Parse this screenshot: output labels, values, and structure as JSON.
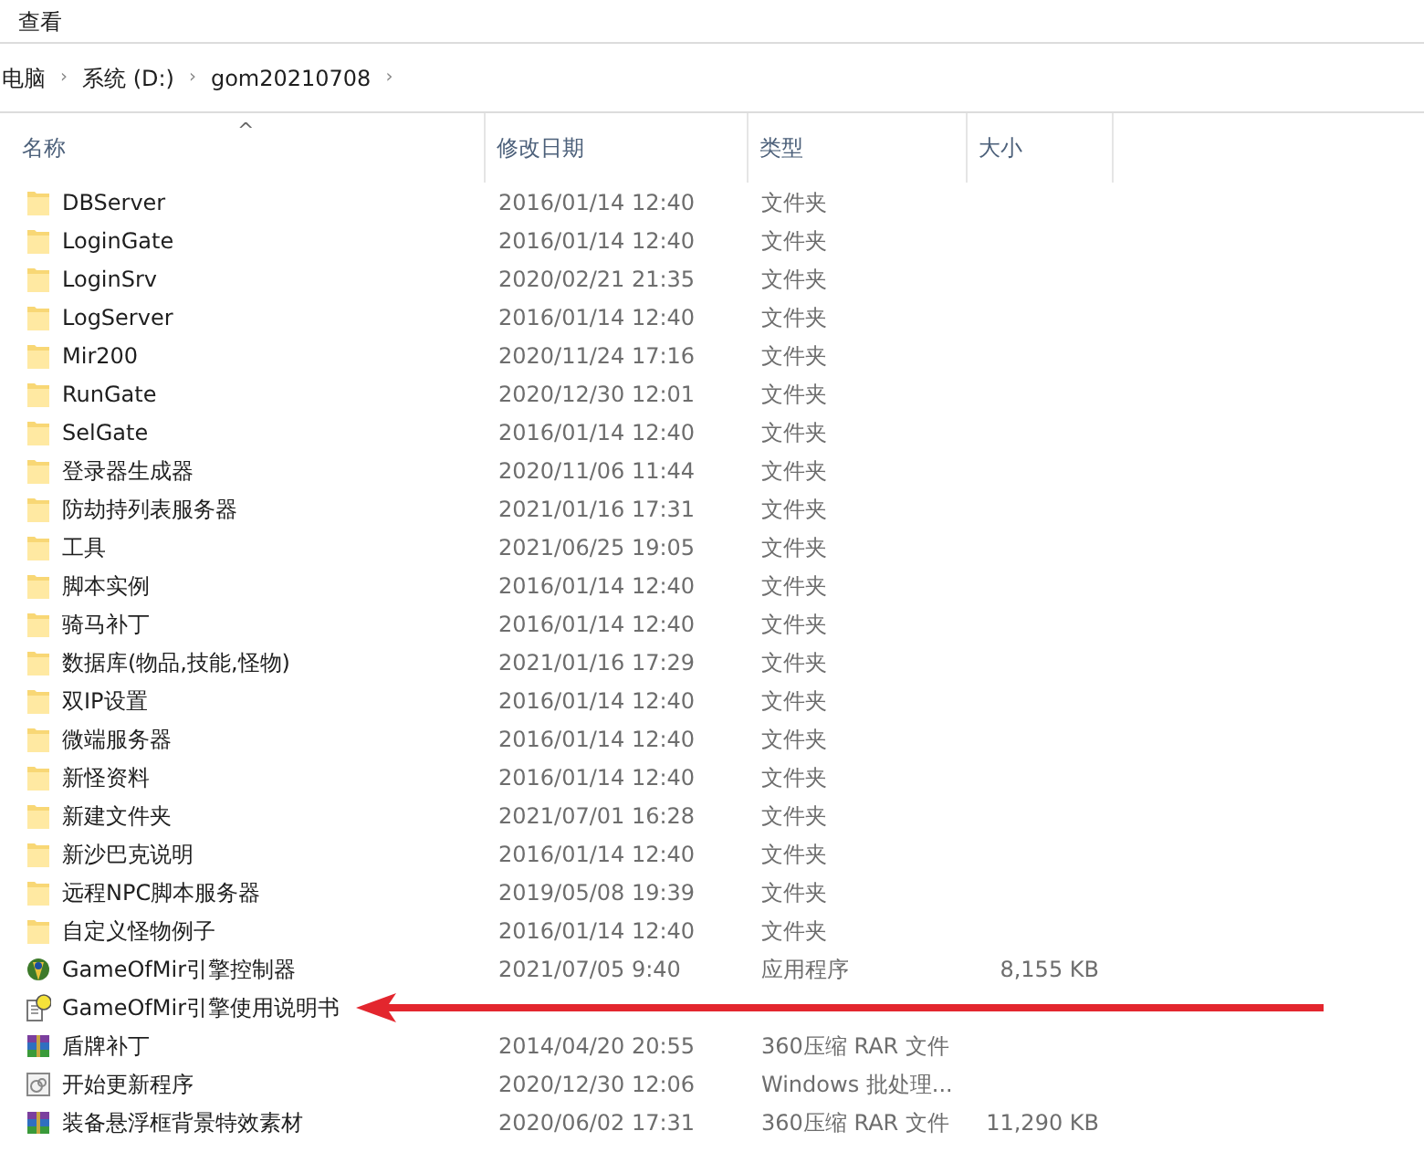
{
  "menu": [
    "查看"
  ],
  "breadcrumb": [
    {
      "label": "电脑",
      "separator": "›"
    },
    {
      "label": "系统 (D:)",
      "separator": "›"
    },
    {
      "label": "gom20210708",
      "separator": "›"
    }
  ],
  "columns": [
    {
      "label": "名称",
      "sort_caret": "^"
    },
    {
      "label": "修改日期"
    },
    {
      "label": "类型"
    },
    {
      "label": "大小"
    }
  ],
  "rows": [
    {
      "name": "DBServer",
      "kind": "folder",
      "date": "2016/01/14 12:40",
      "type": "文件夹"
    },
    {
      "name": "LoginGate",
      "kind": "folder",
      "date": "2016/01/14 12:40",
      "type": "文件夹"
    },
    {
      "name": "LoginSrv",
      "kind": "folder",
      "date": "2020/02/21 21:35",
      "type": "文件夹"
    },
    {
      "name": "LogServer",
      "kind": "folder",
      "date": "2016/01/14 12:40",
      "type": "文件夹"
    },
    {
      "name": "Mir200",
      "kind": "folder",
      "date": "2020/11/24 17:16",
      "type": "文件夹"
    },
    {
      "name": "RunGate",
      "kind": "folder",
      "date": "2020/12/30 12:01",
      "type": "文件夹"
    },
    {
      "name": "SelGate",
      "kind": "folder",
      "date": "2016/01/14 12:40",
      "type": "文件夹"
    },
    {
      "name": "登录器生成器",
      "kind": "folder",
      "date": "2020/11/06 11:44",
      "type": "文件夹"
    },
    {
      "name": "防劫持列表服务器",
      "kind": "folder",
      "date": "2021/01/16 17:31",
      "type": "文件夹"
    },
    {
      "name": "工具",
      "kind": "folder",
      "date": "2021/06/25 19:05",
      "type": "文件夹"
    },
    {
      "name": "脚本实例",
      "kind": "folder",
      "date": "2016/01/14 12:40",
      "type": "文件夹"
    },
    {
      "name": "骑马补丁",
      "kind": "folder",
      "date": "2016/01/14 12:40",
      "type": "文件夹"
    },
    {
      "name": "数据库(物品,技能,怪物)",
      "kind": "folder",
      "date": "2021/01/16 17:29",
      "type": "文件夹"
    },
    {
      "name": "双IP设置",
      "kind": "folder",
      "date": "2016/01/14 12:40",
      "type": "文件夹"
    },
    {
      "name": "微端服务器",
      "kind": "folder",
      "date": "2016/01/14 12:40",
      "type": "文件夹"
    },
    {
      "name": "新怪资料",
      "kind": "folder",
      "date": "2016/01/14 12:40",
      "type": "文件夹"
    },
    {
      "name": "新建文件夹",
      "kind": "folder",
      "date": "2021/07/01 16:28",
      "type": "文件夹"
    },
    {
      "name": "新沙巴克说明",
      "kind": "folder",
      "date": "2016/01/14 12:40",
      "type": "文件夹"
    },
    {
      "name": "远程NPC脚本服务器",
      "kind": "folder",
      "date": "2019/05/08 19:39",
      "type": "文件夹"
    },
    {
      "name": "自定义怪物例子",
      "kind": "folder",
      "date": "2016/01/14 12:40",
      "type": "文件夹"
    },
    {
      "name": "GameOfMir引擎控制器",
      "kind": "app",
      "date": "2021/07/05 9:40",
      "type": "应用程序",
      "size": "8,155 KB"
    },
    {
      "name": "GameOfMir引擎使用说明书",
      "kind": "help",
      "arrow_pointing": true
    },
    {
      "name": "盾牌补丁",
      "kind": "archive",
      "date": "2014/04/20 20:55",
      "type": "360压缩 RAR 文件"
    },
    {
      "name": "开始更新程序",
      "kind": "batch",
      "date": "2020/12/30 12:06",
      "type": "Windows 批处理..."
    },
    {
      "name": "装备悬浮框背景特效素材",
      "kind": "archive",
      "date": "2020/06/02 17:31",
      "type": "360压缩 RAR 文件",
      "size": "11,290 KB"
    }
  ]
}
